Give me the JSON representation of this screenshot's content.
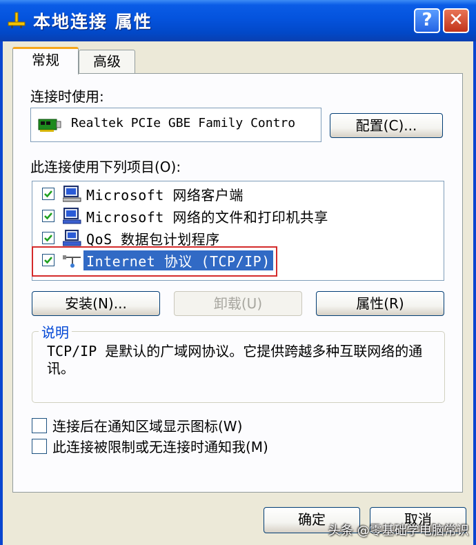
{
  "window": {
    "title": "本地连接 属性",
    "help_glyph": "?",
    "close_glyph": "✕"
  },
  "tabs": [
    {
      "label": "常规"
    },
    {
      "label": "高级"
    }
  ],
  "connect_using": {
    "label": "连接时使用:",
    "adapter": "Realtek PCIe GBE Family Contro",
    "configure_button": "配置(C)..."
  },
  "items_section": {
    "label": "此连接使用下列项目(O):",
    "items": [
      {
        "label": "Microsoft 网络客户端",
        "checked": true,
        "icon": "client-icon"
      },
      {
        "label": "Microsoft 网络的文件和打印机共享",
        "checked": true,
        "icon": "file-printer-sharing-icon"
      },
      {
        "label": "QoS 数据包计划程序",
        "checked": true,
        "icon": "qos-icon"
      },
      {
        "label": "Internet 协议 (TCP/IP)",
        "checked": true,
        "selected": true,
        "icon": "network-protocol-icon"
      }
    ]
  },
  "buttons": {
    "install": "安装(N)...",
    "uninstall": "卸载(U)",
    "properties": "属性(R)"
  },
  "description": {
    "title": "说明",
    "text": "TCP/IP 是默认的广域网协议。它提供跨越多种互联网络的通讯。"
  },
  "options": [
    {
      "label": "连接后在通知区域显示图标(W)",
      "checked": false
    },
    {
      "label": "此连接被限制或无连接时通知我(M)",
      "checked": false
    }
  ],
  "footer": {
    "ok": "确定",
    "cancel": "取消"
  },
  "watermark": "头条 @零基础学电脑常识",
  "colors": {
    "titlebar": "#0453dd",
    "selection": "#316ac5",
    "highlight_box": "#d42a2a",
    "group_title": "#0046d5"
  }
}
